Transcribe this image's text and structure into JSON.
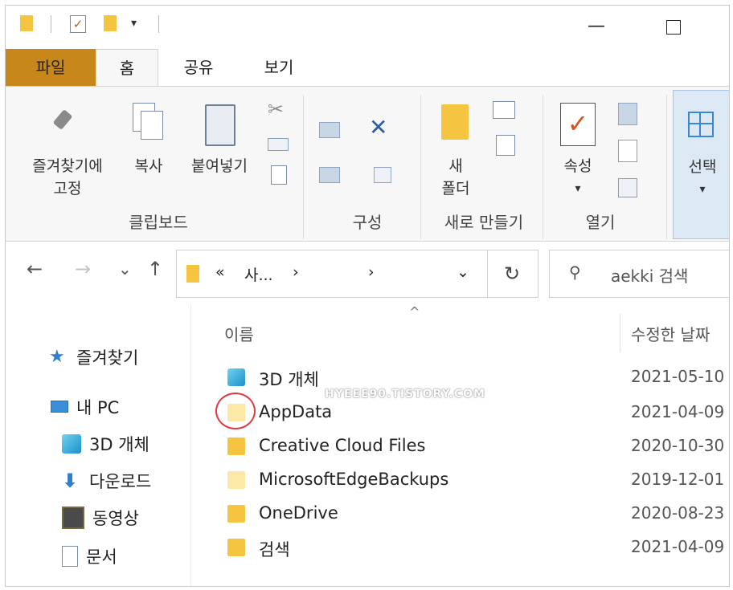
{
  "quick_access": {
    "dropdown_glyph": "▾"
  },
  "window": {
    "minimize_glyph": "—"
  },
  "tabs": [
    {
      "label": "파일"
    },
    {
      "label": "홈"
    },
    {
      "label": "공유"
    },
    {
      "label": "보기"
    }
  ],
  "ribbon": {
    "clipboard": {
      "group_label": "클립보드",
      "pin_label_line1": "즐겨찾기에",
      "pin_label_line2": "고정",
      "copy_label": "복사",
      "paste_label": "붙여넣기"
    },
    "organize": {
      "group_label": "구성"
    },
    "new": {
      "group_label": "새로 만들기",
      "new_folder_line1": "새",
      "new_folder_line2": "폴더"
    },
    "open": {
      "group_label": "열기",
      "properties_label": "속성"
    },
    "select": {
      "label": "선택"
    }
  },
  "address_bar": {
    "back_glyph": "←",
    "forward_glyph": "→",
    "recent_glyph": "⌄",
    "up_glyph": "↑",
    "path_prefix": "«",
    "path_segment": "사...",
    "path_sep1": "›",
    "path_sep2": "›",
    "dropdown_glyph": "⌄",
    "refresh_glyph": "↻",
    "search_placeholder": "aekki 검색"
  },
  "nav_pane": [
    {
      "label": "즐겨찾기",
      "icon": "star-icon"
    },
    {
      "label": "내 PC",
      "icon": "pc-icon"
    },
    {
      "label": "3D 개체",
      "icon": "3d-objects-icon"
    },
    {
      "label": "다운로드",
      "icon": "download-icon"
    },
    {
      "label": "동영상",
      "icon": "video-icon"
    },
    {
      "label": "문서",
      "icon": "document-icon"
    }
  ],
  "file_list": {
    "sort_glyph": "^",
    "columns": {
      "name": "이름",
      "date": "수정한 날짜"
    },
    "files": [
      {
        "name": "3D 개체",
        "date": "2021-05-10",
        "icon": "3d-objects-icon"
      },
      {
        "name": "AppData",
        "date": "2021-04-09",
        "icon": "hidden-folder-icon"
      },
      {
        "name": "Creative Cloud Files",
        "date": "2020-10-30",
        "icon": "folder-icon"
      },
      {
        "name": "MicrosoftEdgeBackups",
        "date": "2019-12-01",
        "icon": "hidden-folder-icon"
      },
      {
        "name": "OneDrive",
        "date": "2020-08-23",
        "icon": "folder-icon"
      },
      {
        "name": "검색",
        "date": "2021-04-09",
        "icon": "search-folder-icon"
      }
    ]
  },
  "watermark": "HYEEE90.TISTORY.COM",
  "colors": {
    "file_tab": "#c7871a",
    "folder": "#f5c542",
    "highlight_circle": "#e23a3a",
    "accent": "#3a86d4"
  }
}
